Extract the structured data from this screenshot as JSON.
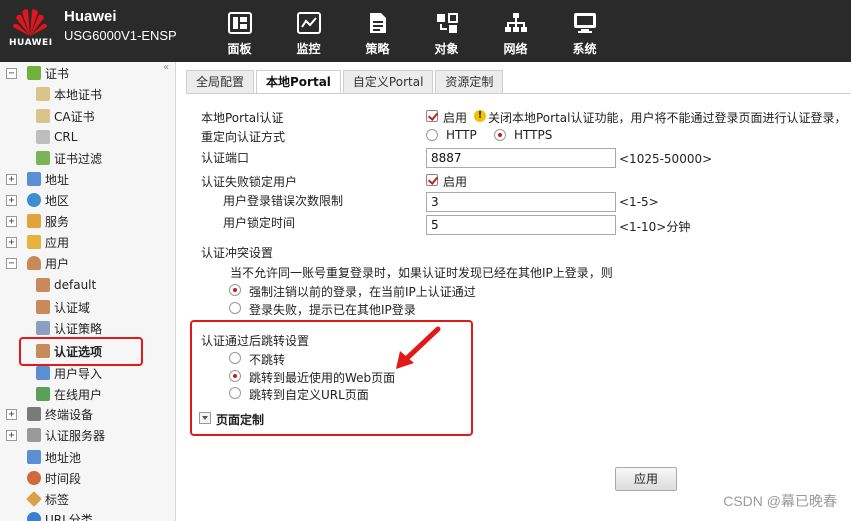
{
  "header": {
    "brand_line1": "Huawei",
    "brand_line2": "USG6000V1-ENSP",
    "logo_text": "HUAWEI",
    "nav": [
      {
        "label": "面板",
        "icon": "dashboard-icon"
      },
      {
        "label": "监控",
        "icon": "monitor-chart-icon"
      },
      {
        "label": "策略",
        "icon": "policy-doc-icon"
      },
      {
        "label": "对象",
        "icon": "object-icon"
      },
      {
        "label": "网络",
        "icon": "network-icon"
      },
      {
        "label": "系统",
        "icon": "system-icon"
      }
    ],
    "active_nav": "对象"
  },
  "sidebar": {
    "collapse_glyph": "«",
    "items": [
      {
        "label": "证书",
        "expander": "−"
      },
      {
        "label": "本地证书"
      },
      {
        "label": "CA证书"
      },
      {
        "label": "CRL"
      },
      {
        "label": "证书过滤"
      },
      {
        "label": "地址",
        "expander": "+"
      },
      {
        "label": "地区",
        "expander": "+"
      },
      {
        "label": "服务",
        "expander": "+"
      },
      {
        "label": "应用",
        "expander": "+"
      },
      {
        "label": "用户",
        "expander": "−"
      },
      {
        "label": "default"
      },
      {
        "label": "认证域"
      },
      {
        "label": "认证策略"
      },
      {
        "label": "认证选项"
      },
      {
        "label": "用户导入"
      },
      {
        "label": "在线用户"
      },
      {
        "label": "终端设备",
        "expander": "+"
      },
      {
        "label": "认证服务器",
        "expander": "+"
      },
      {
        "label": "地址池"
      },
      {
        "label": "时间段"
      },
      {
        "label": "标签"
      },
      {
        "label": "URL分类"
      }
    ],
    "selected": "认证选项"
  },
  "tabs": [
    {
      "label": "全局配置"
    },
    {
      "label": "本地Portal"
    },
    {
      "label": "自定义Portal"
    },
    {
      "label": "资源定制"
    }
  ],
  "form": {
    "local_portal_label": "本地Portal认证",
    "enable_label": "启用",
    "local_portal_warning": "关闭本地Portal认证功能，用户将不能通过登录页面进行认证登录，",
    "redirect_method_label": "重定向认证方式",
    "http_label": "HTTP",
    "https_label": "HTTPS",
    "auth_port_label": "认证端口",
    "auth_port_value": "8887",
    "auth_port_hint": "<1025-50000>",
    "lock_label": "认证失败锁定用户",
    "lock_enable_label": "启用",
    "max_attempts_label": "用户登录错误次数限制",
    "max_attempts_value": "3",
    "max_attempts_hint": "<1-5>",
    "lock_time_label": "用户锁定时间",
    "lock_time_value": "5",
    "lock_time_hint": "<1-10>分钟",
    "conflict_label": "认证冲突设置",
    "conflict_desc": "当不允许同一账号重复登录时，如果认证时发现已经在其他IP上登录，则",
    "conflict_opt1": "强制注销以前的登录，在当前IP上认证通过",
    "conflict_opt2": "登录失败，提示已在其他IP登录",
    "redirect_after_label": "认证通过后跳转设置",
    "redirect_opt1": "不跳转",
    "redirect_opt2": "跳转到最近使用的Web页面",
    "redirect_opt3": "跳转到自定义URL页面",
    "page_custom_label": "页面定制",
    "apply_label": "应用"
  },
  "watermark": "CSDN @幕已晚春",
  "colors": {
    "header_bg": "#2a2a2a",
    "accent_red": "#c81d1d",
    "highlight_red": "#e21919"
  }
}
